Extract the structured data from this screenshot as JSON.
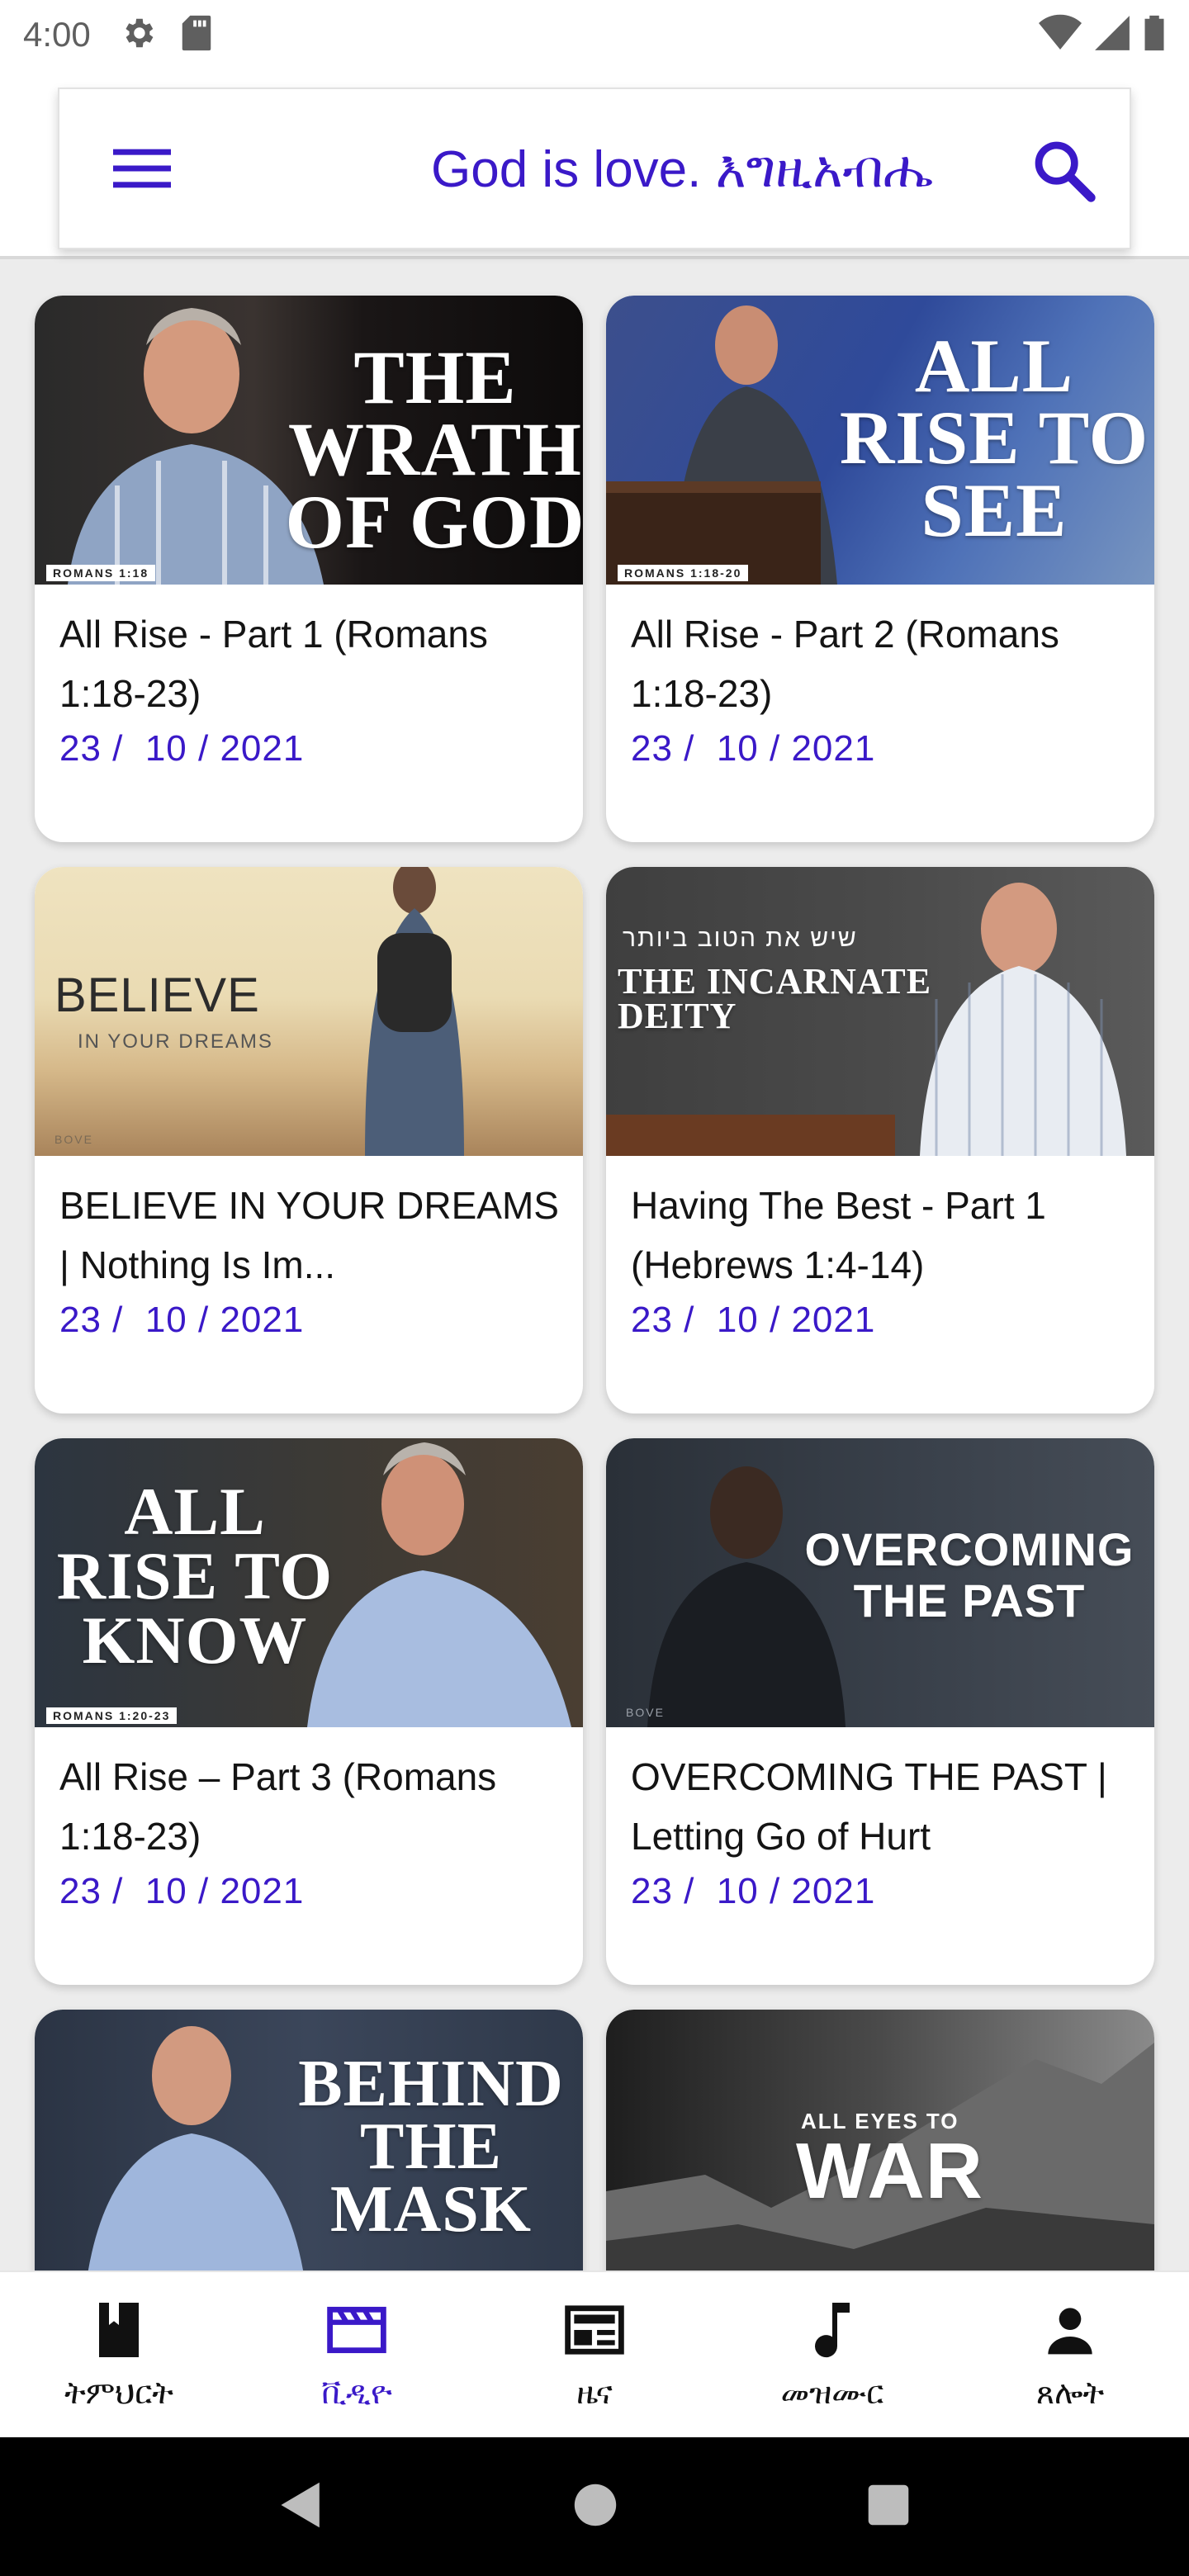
{
  "status_bar": {
    "time": "4:00"
  },
  "header": {
    "title": "God is love. እግዚአብሔ"
  },
  "cards": [
    {
      "title": "All Rise - Part 1 (Romans 1:18-23)",
      "date": "23 /  10 / 2021",
      "thumb": {
        "text": "THE WRATH OF GOD",
        "ref": "ROMANS 1:18"
      }
    },
    {
      "title": "All Rise - Part 2 (Romans 1:18-23)",
      "date": "23 /  10 / 2021",
      "thumb": {
        "text": "ALL RISE TO SEE",
        "ref": "ROMANS 1:18-20"
      }
    },
    {
      "title": "BELIEVE IN YOUR DREAMS | Nothing Is Im...",
      "date": "23 /  10 / 2021",
      "thumb": {
        "text": "BELIEVE",
        "sub": "IN YOUR DREAMS",
        "ref": "BOVE"
      }
    },
    {
      "title": "Having The Best - Part 1 (Hebrews 1:4-14)",
      "date": "23 /  10 / 2021",
      "thumb": {
        "top": "שיש את הטוב ביותר",
        "text": "THE INCARNATE DEITY"
      }
    },
    {
      "title": "All Rise – Part 3 (Romans 1:18-23)",
      "date": "23 /  10 / 2021",
      "thumb": {
        "text": "ALL RISE TO KNOW",
        "ref": "ROMANS 1:20-23"
      }
    },
    {
      "title": "OVERCOMING THE PAST | Letting Go of Hurt",
      "date": "23 /  10 / 2021",
      "thumb": {
        "text": "OVERCOMING THE PAST",
        "ref": "BOVE"
      }
    },
    {
      "title": "",
      "date": "",
      "thumb": {
        "text": "BEHIND THE MASK"
      }
    },
    {
      "title": "",
      "date": "",
      "thumb": {
        "top": "ALL EYES TO",
        "text": "WAR"
      }
    }
  ],
  "bottom_nav": [
    {
      "label": "ትምህርት",
      "icon": "book-icon",
      "active": false
    },
    {
      "label": "ቪዲዮ",
      "icon": "video-icon",
      "active": true
    },
    {
      "label": "ዜና",
      "icon": "news-icon",
      "active": false
    },
    {
      "label": "መዝሙር",
      "icon": "music-note-icon",
      "active": false
    },
    {
      "label": "ጸሎት",
      "icon": "person-icon",
      "active": false
    }
  ],
  "colors": {
    "accent": "#3a19c8",
    "text": "#141414",
    "background": "#ececec"
  }
}
